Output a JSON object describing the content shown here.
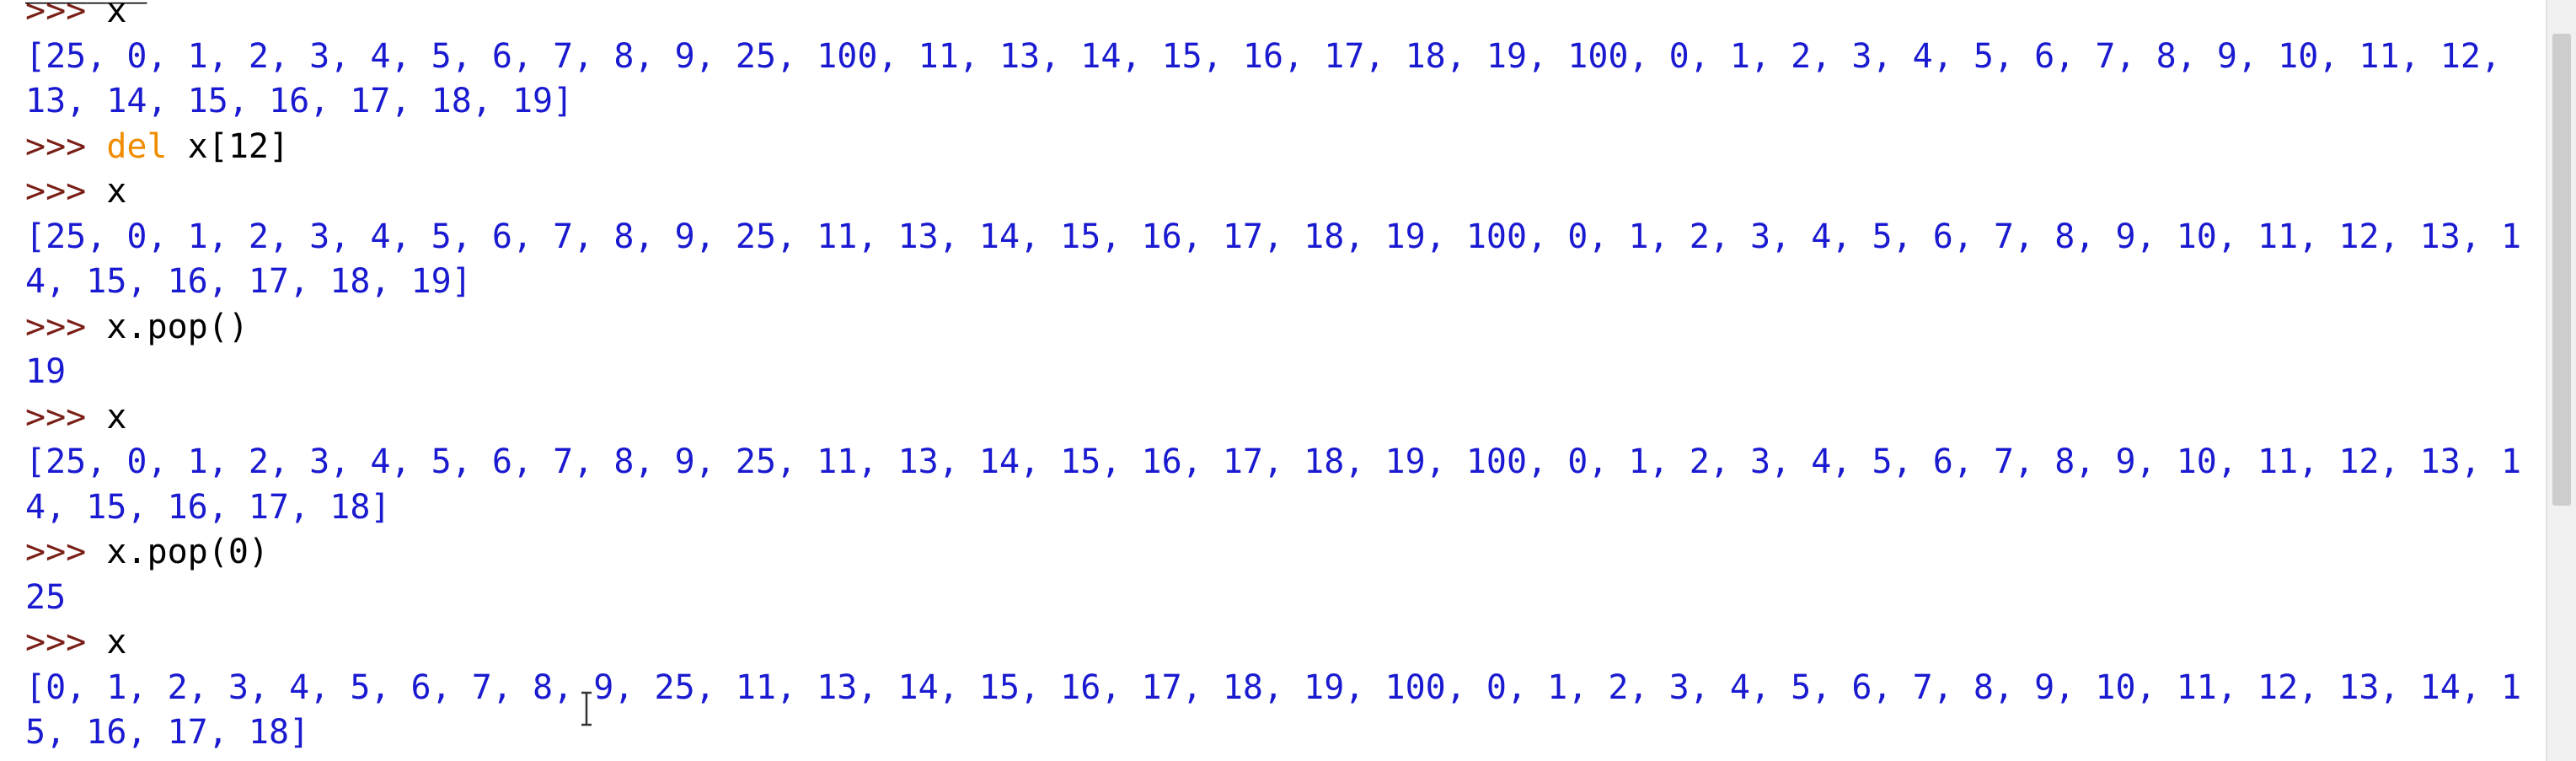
{
  "prompt": ">>> ",
  "session": [
    {
      "type": "input",
      "text": "x"
    },
    {
      "type": "output",
      "text": "[25, 0, 1, 2, 3, 4, 5, 6, 7, 8, 9, 25, 100, 11, 13, 14, 15, 16, 17, 18, 19, 100, 0, 1, 2, 3, 4, 5, 6, 7, 8, 9, 10, 11, 12,"
    },
    {
      "type": "output",
      "text": "13, 14, 15, 16, 17, 18, 19]"
    },
    {
      "type": "input",
      "kw": "del",
      "text": " x[12]"
    },
    {
      "type": "input",
      "text": "x"
    },
    {
      "type": "output",
      "text": "[25, 0, 1, 2, 3, 4, 5, 6, 7, 8, 9, 25, 11, 13, 14, 15, 16, 17, 18, 19, 100, 0, 1, 2, 3, 4, 5, 6, 7, 8, 9, 10, 11, 12, 13, 1"
    },
    {
      "type": "output",
      "text": "4, 15, 16, 17, 18, 19]"
    },
    {
      "type": "input",
      "text": "x.pop()"
    },
    {
      "type": "output",
      "text": "19"
    },
    {
      "type": "input",
      "text": "x"
    },
    {
      "type": "output",
      "text": "[25, 0, 1, 2, 3, 4, 5, 6, 7, 8, 9, 25, 11, 13, 14, 15, 16, 17, 18, 19, 100, 0, 1, 2, 3, 4, 5, 6, 7, 8, 9, 10, 11, 12, 13, 1"
    },
    {
      "type": "output",
      "text": "4, 15, 16, 17, 18]"
    },
    {
      "type": "input",
      "text": "x.pop(0)"
    },
    {
      "type": "output",
      "text": "25"
    },
    {
      "type": "input",
      "text": "x"
    },
    {
      "type": "output",
      "text": "[0, 1, 2, 3, 4, 5, 6, 7, 8, 9, 25, 11, 13, 14, 15, 16, 17, 18, 19, 100, 0, 1, 2, 3, 4, 5, 6, 7, 8, 9, 10, 11, 12, 13, 14, 1"
    },
    {
      "type": "output",
      "text": "5, 16, 17, 18]"
    }
  ],
  "colors": {
    "prompt": "#7a1f17",
    "keyword": "#f08c00",
    "output": "#1a1ad0",
    "input": "#000000"
  },
  "icons": {
    "cursor": "text-ibeam-cursor-icon"
  }
}
